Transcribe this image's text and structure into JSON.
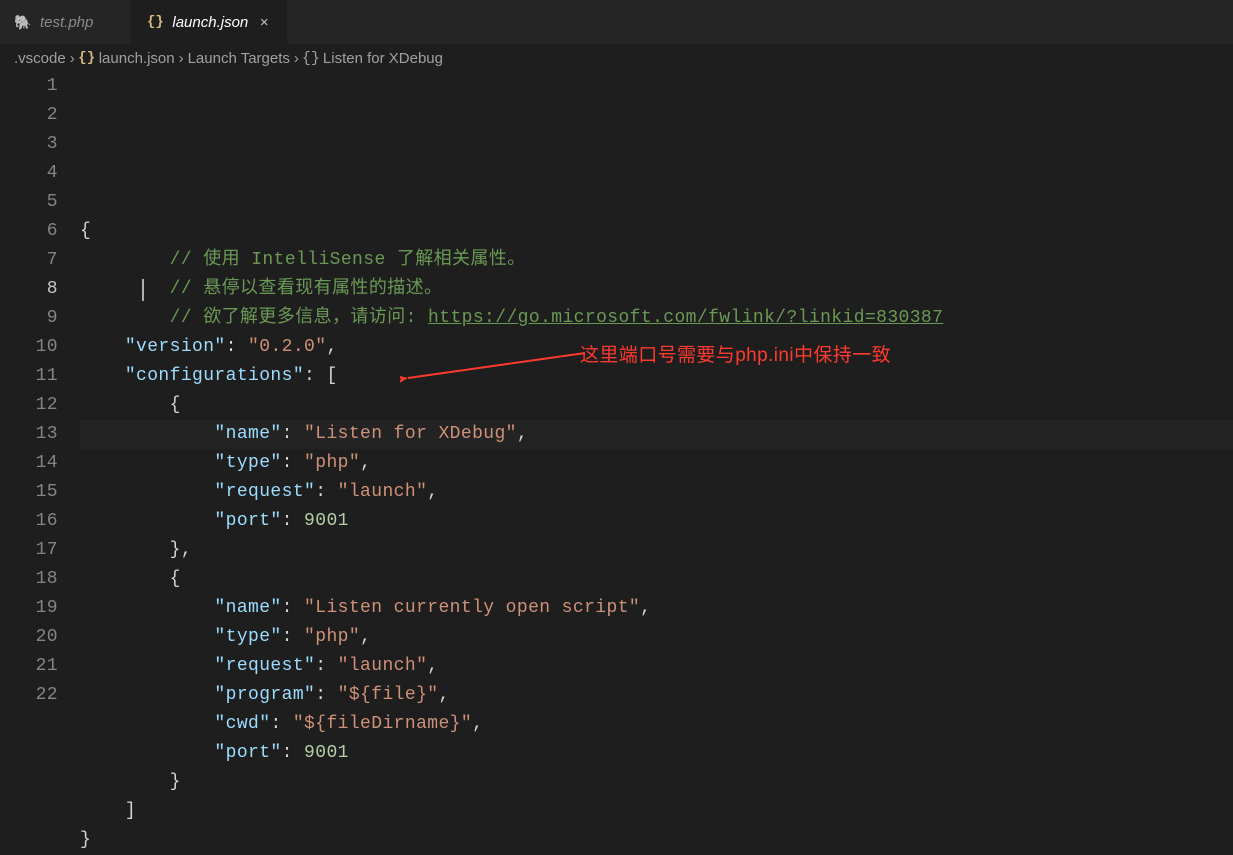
{
  "tabs": [
    {
      "icon": "elephant",
      "label": "test.php",
      "active": false
    },
    {
      "icon": "json",
      "label": "launch.json",
      "active": true
    }
  ],
  "breadcrumbs": {
    "parts": [
      {
        "icon": null,
        "label": ".vscode"
      },
      {
        "icon": "json",
        "label": "launch.json"
      },
      {
        "icon": null,
        "label": "Launch Targets"
      },
      {
        "icon": "braces",
        "label": "Listen for XDebug"
      }
    ]
  },
  "lines": [
    {
      "n": 1,
      "indent": 0,
      "type": "brace",
      "text": "{"
    },
    {
      "n": 2,
      "indent": 2,
      "type": "comment",
      "pre": "// 使用 ",
      "em": "IntelliSense",
      "post": " 了解相关属性。"
    },
    {
      "n": 3,
      "indent": 2,
      "type": "comment",
      "text": "// 悬停以查看现有属性的描述。"
    },
    {
      "n": 4,
      "indent": 2,
      "type": "comment-link",
      "pre": "// 欲了解更多信息，请访问: ",
      "link": "https://go.microsoft.com/fwlink/?linkid=830387"
    },
    {
      "n": 5,
      "indent": 1,
      "type": "kv-str",
      "key": "version",
      "val": "0.2.0",
      "comma": true
    },
    {
      "n": 6,
      "indent": 1,
      "type": "kv-open",
      "key": "configurations",
      "open": "["
    },
    {
      "n": 7,
      "indent": 2,
      "type": "brace",
      "text": "{"
    },
    {
      "n": 8,
      "indent": 3,
      "type": "kv-str",
      "key": "name",
      "val": "Listen for XDebug",
      "comma": true,
      "current": true
    },
    {
      "n": 9,
      "indent": 3,
      "type": "kv-str",
      "key": "type",
      "val": "php",
      "comma": true
    },
    {
      "n": 10,
      "indent": 3,
      "type": "kv-str",
      "key": "request",
      "val": "launch",
      "comma": true
    },
    {
      "n": 11,
      "indent": 3,
      "type": "kv-num",
      "key": "port",
      "val": "9001"
    },
    {
      "n": 12,
      "indent": 2,
      "type": "brace",
      "text": "},",
      "comma": false
    },
    {
      "n": 13,
      "indent": 2,
      "type": "brace",
      "text": "{"
    },
    {
      "n": 14,
      "indent": 3,
      "type": "kv-str",
      "key": "name",
      "val": "Listen currently open script",
      "comma": true
    },
    {
      "n": 15,
      "indent": 3,
      "type": "kv-str",
      "key": "type",
      "val": "php",
      "comma": true
    },
    {
      "n": 16,
      "indent": 3,
      "type": "kv-str",
      "key": "request",
      "val": "launch",
      "comma": true
    },
    {
      "n": 17,
      "indent": 3,
      "type": "kv-str",
      "key": "program",
      "val": "${file}",
      "comma": true
    },
    {
      "n": 18,
      "indent": 3,
      "type": "kv-str",
      "key": "cwd",
      "val": "${fileDirname}",
      "comma": true
    },
    {
      "n": 19,
      "indent": 3,
      "type": "kv-num",
      "key": "port",
      "val": "9001"
    },
    {
      "n": 20,
      "indent": 2,
      "type": "brace",
      "text": "}"
    },
    {
      "n": 21,
      "indent": 1,
      "type": "brace",
      "text": "]"
    },
    {
      "n": 22,
      "indent": 0,
      "type": "brace",
      "text": "}"
    }
  ],
  "annotation": {
    "text": "这里端口号需要与php.ini中保持一致"
  }
}
